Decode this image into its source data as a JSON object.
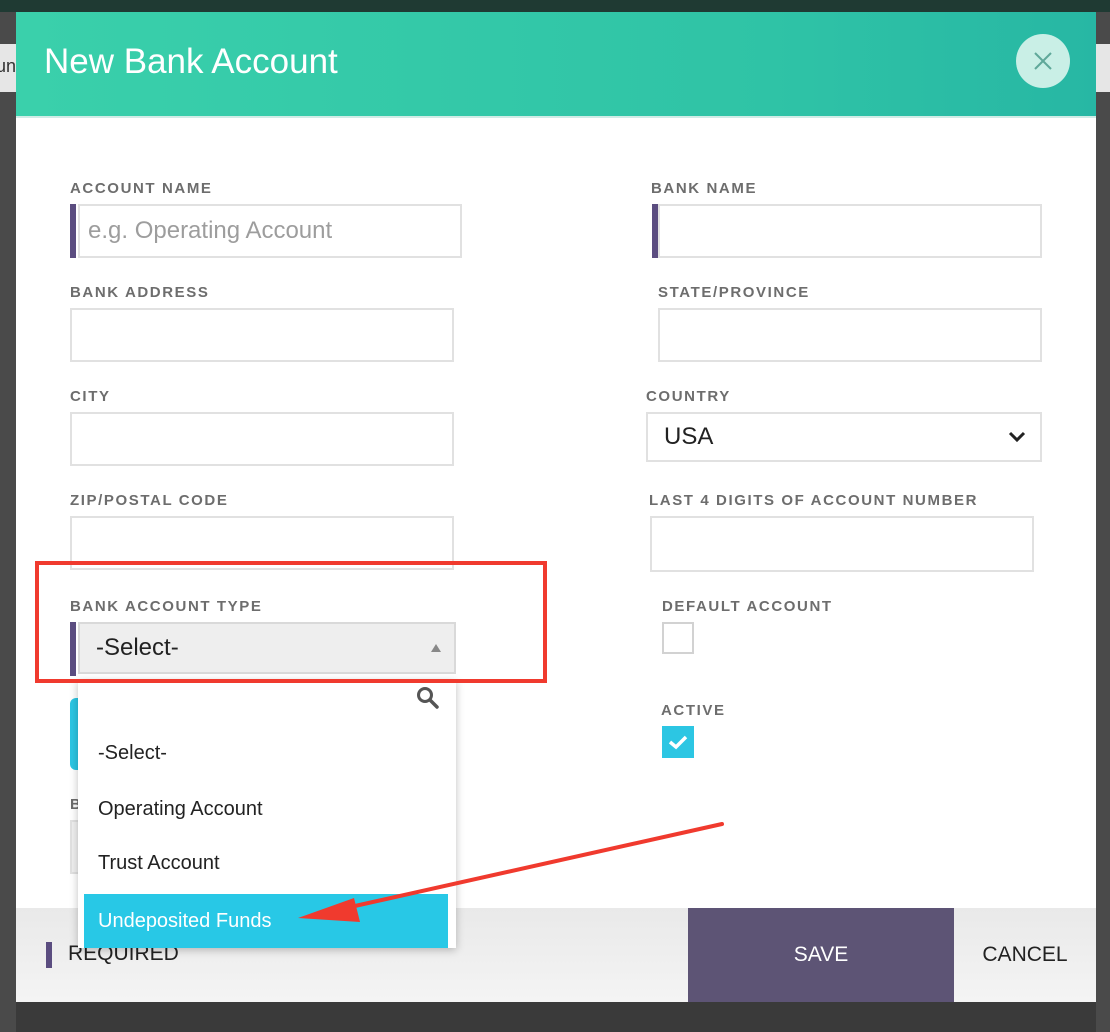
{
  "background": {
    "partial_text": "un"
  },
  "modal": {
    "title": "New Bank Account",
    "close_icon": "close-icon"
  },
  "form": {
    "account_name": {
      "label": "ACCOUNT NAME",
      "placeholder": "e.g. Operating Account",
      "value": ""
    },
    "bank_name": {
      "label": "BANK NAME",
      "value": ""
    },
    "bank_address": {
      "label": "BANK ADDRESS",
      "value": ""
    },
    "state_province": {
      "label": "STATE/PROVINCE",
      "value": ""
    },
    "city": {
      "label": "CITY",
      "value": ""
    },
    "country": {
      "label": "COUNTRY",
      "value": "USA"
    },
    "zip": {
      "label": "ZIP/POSTAL CODE",
      "value": ""
    },
    "last4": {
      "label": "LAST 4 DIGITS OF ACCOUNT NUMBER",
      "value": ""
    },
    "bank_account_type": {
      "label": "BANK ACCOUNT TYPE",
      "value": "-Select-",
      "options": [
        "-Select-",
        "Operating Account",
        "Trust Account",
        "Undeposited Funds"
      ],
      "highlighted": "Undeposited Funds"
    },
    "default_account": {
      "label": "DEFAULT ACCOUNT",
      "checked": false
    },
    "active": {
      "label": "ACTIVE",
      "checked": true
    },
    "hidden_label_initial": "B"
  },
  "footer": {
    "required_label": "REQUIRED",
    "save_label": "SAVE",
    "cancel_label": "CANCEL"
  },
  "colors": {
    "header_teal": "#3ad0ab",
    "required_purple": "#5b4d80",
    "save_button": "#5d5475",
    "checkbox_blue": "#2cc6e3",
    "highlight_blue": "#28c8e6",
    "annotation_red": "#f03a2e"
  }
}
